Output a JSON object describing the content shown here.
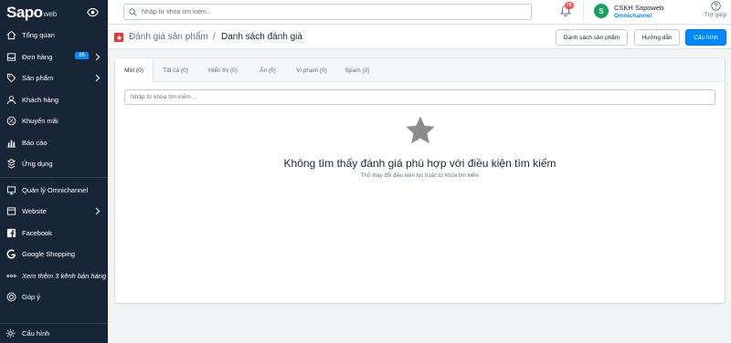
{
  "brand": {
    "logo": "Sapo",
    "sub": "web"
  },
  "sidebar": {
    "items": [
      {
        "label": "Tổng quan",
        "icon": "home-icon"
      },
      {
        "label": "Đơn hàng",
        "icon": "inbox-icon",
        "badge": "86",
        "chevron": true
      },
      {
        "label": "Sản phẩm",
        "icon": "tag-icon",
        "chevron": true
      },
      {
        "label": "Khách hàng",
        "icon": "user-icon"
      },
      {
        "label": "Khuyến mãi",
        "icon": "discount-icon"
      },
      {
        "label": "Báo cáo",
        "icon": "chart-icon"
      },
      {
        "label": "Ứng dụng",
        "icon": "apps-icon"
      },
      {
        "label": "Quản lý Omnichannel",
        "icon": "omnichannel-icon"
      },
      {
        "label": "Website",
        "icon": "website-icon",
        "chevron": true
      },
      {
        "label": "Facebook",
        "icon": "facebook-icon"
      },
      {
        "label": "Google Shopping",
        "icon": "google-icon"
      },
      {
        "label": "Xem thêm 3 kênh bán hàng",
        "icon": "more-icon"
      },
      {
        "label": "Góp ý",
        "icon": "feedback-icon"
      }
    ],
    "settings_label": "Cấu hình"
  },
  "topbar": {
    "search_placeholder": "Nhập từ khóa tìm kiếm...",
    "notification_count": "78",
    "user_initial": "S",
    "user_name": "CSKH Sapoweb",
    "user_role": "Omnichannel",
    "help_label": "Trợ giúp"
  },
  "header": {
    "breadcrumb_parent": "Đánh giá sản phẩm",
    "breadcrumb_sep": "/",
    "breadcrumb_current": "Danh sách đánh giá",
    "buttons": {
      "review_list": "Danh sách sản phẩm",
      "guide": "Hướng dẫn",
      "settings": "Cấu hình"
    }
  },
  "tabs": [
    {
      "label": "Mới (0)"
    },
    {
      "label": "Tất cả (0)"
    },
    {
      "label": "Hiển thị (0)"
    },
    {
      "label": "Ẩn (0)"
    },
    {
      "label": "Vi phạm (0)"
    },
    {
      "label": "Spam (0)"
    }
  ],
  "filter_placeholder": "Nhập từ khóa tìm kiếm ...",
  "empty": {
    "title": "Không tìm thấy đánh giá phù hợp với điều kiện tìm kiếm",
    "subtitle": "Thử thay đổi điều kiện lọc hoặc từ khóa tìm kiếm"
  },
  "colors": {
    "sidebar_bg": "#182537",
    "primary": "#0088ff",
    "badge_red": "#ff4d4d",
    "avatar_green": "#19a15f",
    "breadcrumb_icon": "#e5353b"
  }
}
